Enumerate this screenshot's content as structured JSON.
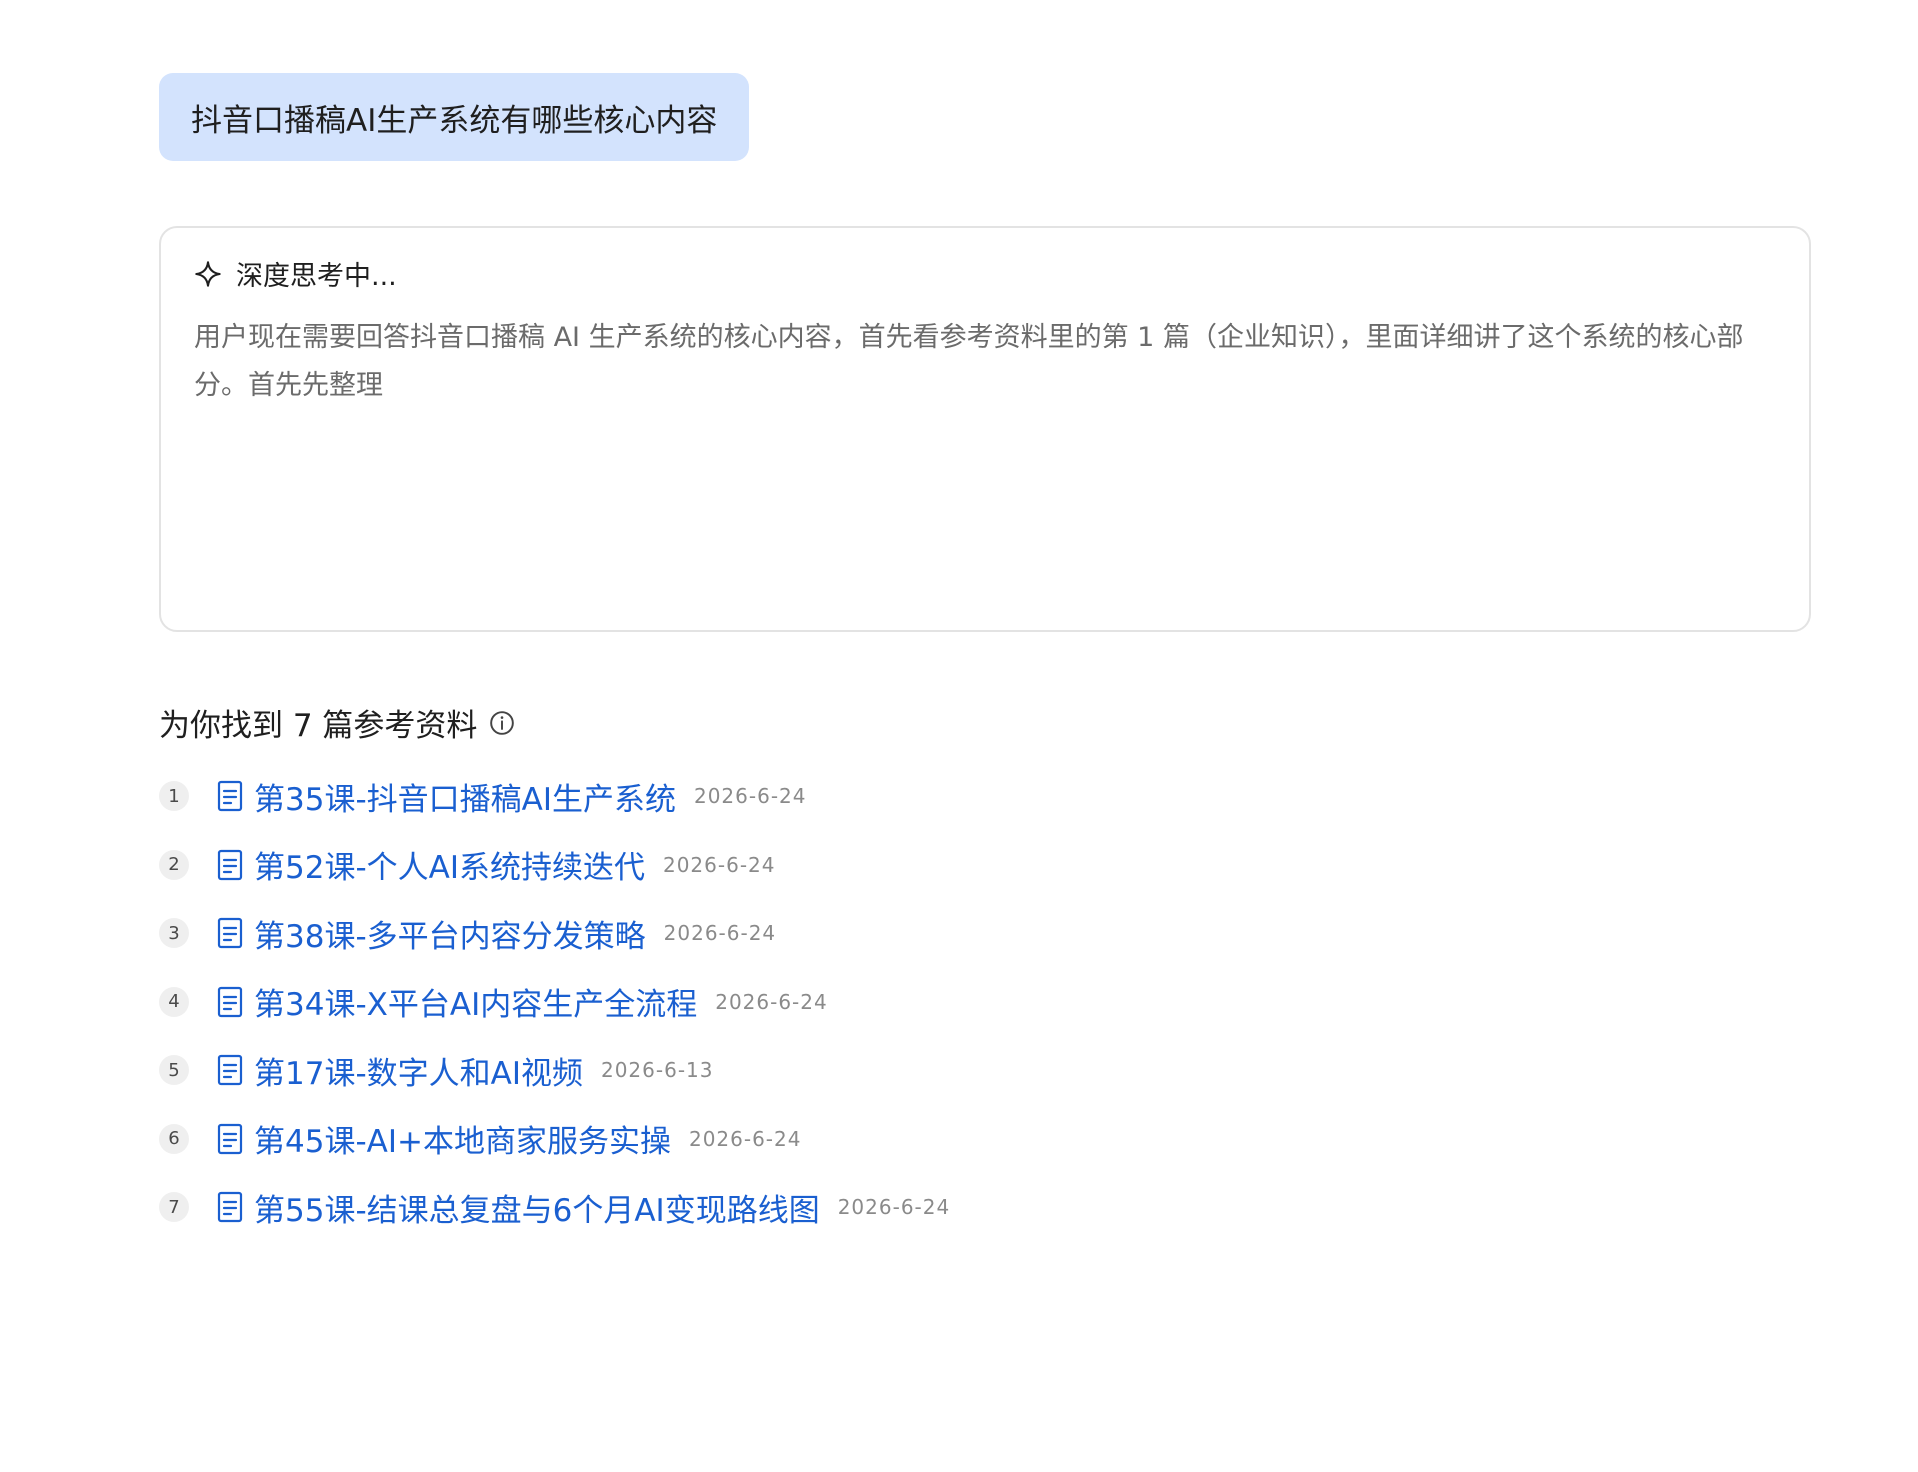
{
  "query": {
    "text": "抖音口播稿AI生产系统有哪些核心内容"
  },
  "thinking": {
    "icon": "sparkle-icon",
    "status": "深度思考中...",
    "content": "用户现在需要回答抖音口播稿 AI 生产系统的核心内容，首先看参考资料里的第 1 篇（企业知识），里面详细讲了这个系统的核心部分。首先先整理"
  },
  "references": {
    "heading": "为你找到 7 篇参考资料",
    "info_icon": "info-icon",
    "doc_icon": "document-icon",
    "link_color": "#1a5fd0",
    "items": [
      {
        "index": "1",
        "title": "第35课-抖音口播稿AI生产系统",
        "date": "2026-6-24"
      },
      {
        "index": "2",
        "title": "第52课-个人AI系统持续迭代",
        "date": "2026-6-24"
      },
      {
        "index": "3",
        "title": "第38课-多平台内容分发策略",
        "date": "2026-6-24"
      },
      {
        "index": "4",
        "title": "第34课-X平台AI内容生产全流程",
        "date": "2026-6-24"
      },
      {
        "index": "5",
        "title": "第17课-数字人和AI视频",
        "date": "2026-6-13"
      },
      {
        "index": "6",
        "title": "第45课-AI+本地商家服务实操",
        "date": "2026-6-24"
      },
      {
        "index": "7",
        "title": "第55课-结课总复盘与6个月AI变现路线图",
        "date": "2026-6-24"
      }
    ]
  }
}
